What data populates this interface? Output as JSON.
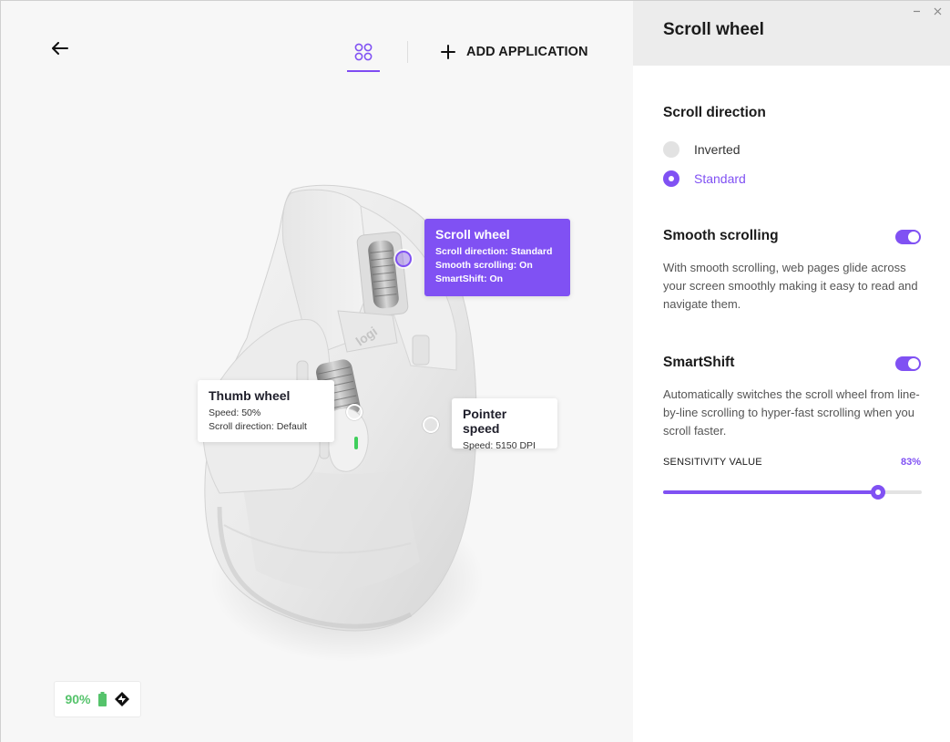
{
  "topnav": {
    "add_application_label": "ADD APPLICATION"
  },
  "device": {
    "logo_text": "logi"
  },
  "callouts": {
    "scroll_wheel": {
      "title": "Scroll wheel",
      "lines": [
        "Scroll direction: Standard",
        "Smooth scrolling: On",
        "SmartShift: On"
      ]
    },
    "thumb_wheel": {
      "title": "Thumb wheel",
      "lines": [
        "Speed: 50%",
        "Scroll direction: Default"
      ]
    },
    "pointer_speed": {
      "title": "Pointer speed",
      "lines": [
        "Speed: 5150 DPI"
      ]
    }
  },
  "battery": {
    "percent_text": "90%",
    "level": 0.9
  },
  "panel": {
    "title": "Scroll wheel",
    "scroll_direction": {
      "title": "Scroll direction",
      "options": [
        "Inverted",
        "Standard"
      ],
      "selected": "Standard"
    },
    "smooth_scrolling": {
      "title": "Smooth scrolling",
      "enabled": true,
      "description": "With smooth scrolling, web pages glide across your screen smoothly making it easy to read and navigate them."
    },
    "smartshift": {
      "title": "SmartShift",
      "enabled": true,
      "description": "Automatically switches the scroll wheel from line-by-line scrolling to hyper-fast scrolling when you scroll faster.",
      "sensitivity_label": "SENSITIVITY VALUE",
      "sensitivity_text": "83%",
      "sensitivity_value": 83
    }
  },
  "colors": {
    "accent": "#8051f3",
    "battery_green": "#55c36b"
  }
}
